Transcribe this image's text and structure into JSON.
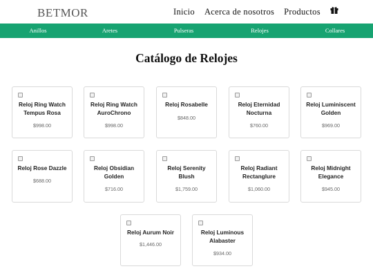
{
  "header": {
    "logo": "BETMOR",
    "nav": [
      "Inicio",
      "Acerca de nosotros",
      "Productos"
    ],
    "cart_icon": "gift-icon"
  },
  "categories": [
    "Anillos",
    "Aretes",
    "Pulseras",
    "Relojes",
    "Collares"
  ],
  "page_title": "Catálogo de Relojes",
  "products": [
    {
      "name": "Reloj Ring Watch Tempus Rosa",
      "price": "$998.00"
    },
    {
      "name": "Reloj Ring Watch AuroChrono",
      "price": "$998.00"
    },
    {
      "name": "Reloj Rosabelle",
      "price": "$848.00"
    },
    {
      "name": "Reloj Eternidad Nocturna",
      "price": "$760.00"
    },
    {
      "name": "Reloj Luminiscent Golden",
      "price": "$969.00"
    },
    {
      "name": "Reloj Rose Dazzle",
      "price": "$688.00"
    },
    {
      "name": "Reloj Obsidian Golden",
      "price": "$716.00"
    },
    {
      "name": "Reloj Serenity Blush",
      "price": "$1,759.00"
    },
    {
      "name": "Reloj Radiant Rectanglure",
      "price": "$1,060.00"
    },
    {
      "name": "Reloj Midnight Elegance",
      "price": "$945.00"
    },
    {
      "name": "Reloj Aurum Noir",
      "price": "$1,446.00"
    },
    {
      "name": "Reloj Luminous Alabaster",
      "price": "$934.00"
    }
  ],
  "colors": {
    "accent": "#17a371"
  }
}
